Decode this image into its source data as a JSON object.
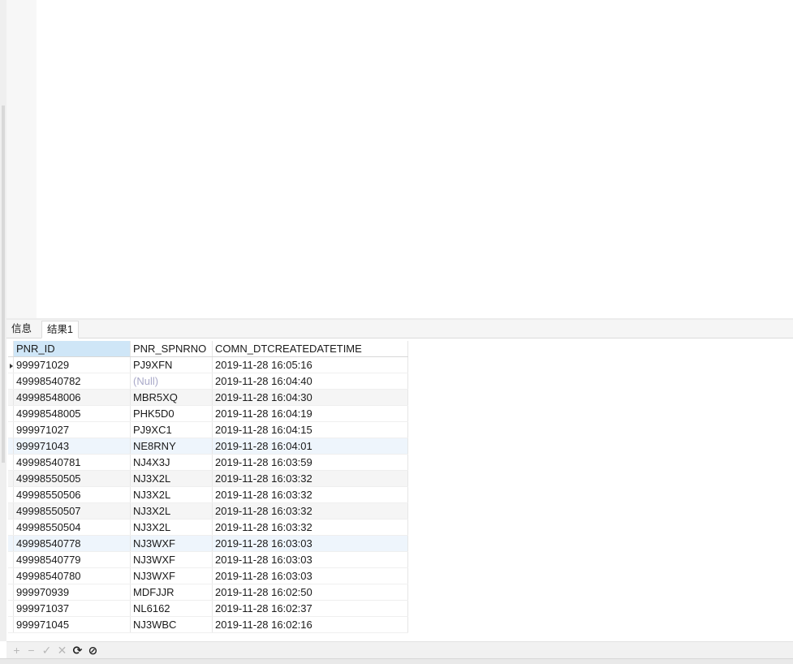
{
  "tabs": [
    {
      "label": "信息",
      "active": false
    },
    {
      "label": "结果1",
      "active": true
    }
  ],
  "grid": {
    "columns": [
      "PNR_ID",
      "PNR_SPNRNO",
      "COMN_DTCREATEDATETIME"
    ],
    "rows": [
      [
        "999971029",
        "PJ9XFN",
        "2019-11-28 16:05:16"
      ],
      [
        "49998540782",
        "(Null)",
        "2019-11-28 16:04:40"
      ],
      [
        "49998548006",
        "MBR5XQ",
        "2019-11-28 16:04:30"
      ],
      [
        "49998548005",
        "PHK5D0",
        "2019-11-28 16:04:19"
      ],
      [
        "999971027",
        "PJ9XC1",
        "2019-11-28 16:04:15"
      ],
      [
        "999971043",
        "NE8RNY",
        "2019-11-28 16:04:01"
      ],
      [
        "49998540781",
        "NJ4X3J",
        "2019-11-28 16:03:59"
      ],
      [
        "49998550505",
        "NJ3X2L",
        "2019-11-28 16:03:32"
      ],
      [
        "49998550506",
        "NJ3X2L",
        "2019-11-28 16:03:32"
      ],
      [
        "49998550507",
        "NJ3X2L",
        "2019-11-28 16:03:32"
      ],
      [
        "49998550504",
        "NJ3X2L",
        "2019-11-28 16:03:32"
      ],
      [
        "49998540778",
        "NJ3WXF",
        "2019-11-28 16:03:03"
      ],
      [
        "49998540779",
        "NJ3WXF",
        "2019-11-28 16:03:03"
      ],
      [
        "49998540780",
        "NJ3WXF",
        "2019-11-28 16:03:03"
      ],
      [
        "999970939",
        "MDFJJR",
        "2019-11-28 16:02:50"
      ],
      [
        "999971037",
        "NL6162",
        "2019-11-28 16:02:37"
      ],
      [
        "999971045",
        "NJ3WBC",
        "2019-11-28 16:02:16"
      ]
    ]
  },
  "toolbar": {
    "add": {
      "icon": "plus-icon",
      "glyph": "+"
    },
    "delete": {
      "icon": "minus-icon",
      "glyph": "−"
    },
    "apply": {
      "icon": "check-icon",
      "glyph": "✓"
    },
    "cancel": {
      "icon": "x-icon",
      "glyph": "✕"
    },
    "refresh": {
      "icon": "refresh-icon",
      "glyph": "⟳"
    },
    "stop": {
      "icon": "stop-icon",
      "glyph": "⊘"
    }
  },
  "colors": {
    "selected_header": "#cfe6f7",
    "null_text": "#a9a9c9",
    "alt_row": "#f5f5f5"
  }
}
